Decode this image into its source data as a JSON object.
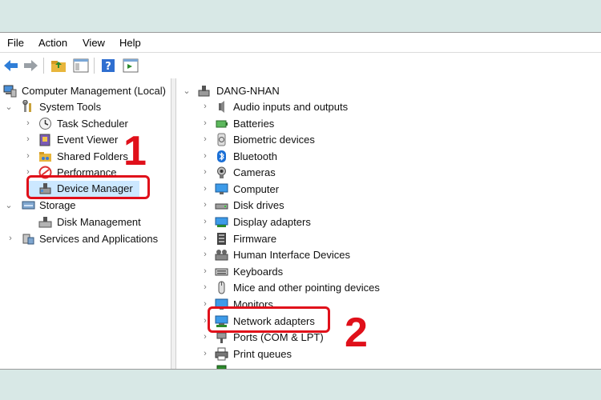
{
  "menu": [
    "File",
    "Action",
    "View",
    "Help"
  ],
  "left_tree": {
    "root": "Computer Management (Local)",
    "system_tools": "System Tools",
    "task_scheduler": "Task Scheduler",
    "event_viewer": "Event Viewer",
    "shared_folders": "Shared Folders",
    "performance": "Performance",
    "device_manager": "Device Manager",
    "storage": "Storage",
    "disk_management": "Disk Management",
    "services": "Services and Applications"
  },
  "right_tree": {
    "root": "DANG-NHAN",
    "items": [
      "Audio inputs and outputs",
      "Batteries",
      "Biometric devices",
      "Bluetooth",
      "Cameras",
      "Computer",
      "Disk drives",
      "Display adapters",
      "Firmware",
      "Human Interface Devices",
      "Keyboards",
      "Mice and other pointing devices",
      "Monitors",
      "Network adapters",
      "Ports (COM & LPT)",
      "Print queues"
    ]
  },
  "annotations": {
    "step1": "1",
    "step2": "2"
  },
  "colors": {
    "callout": "#e0101a",
    "selection": "#cce8ff",
    "background": "#d8e8e6"
  }
}
